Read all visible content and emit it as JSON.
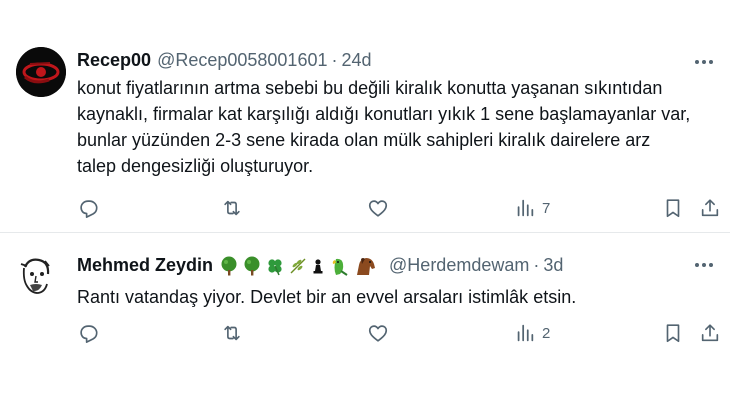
{
  "tweets": [
    {
      "display_name": "Recep00",
      "handle": "@Recep0058001601",
      "separator": "·",
      "time": "24d",
      "text_lines": [
        "konut fiyatlarının artma sebebi bu değili kiralık konutta yaşanan sıkıntıdan",
        "kaynaklı, firmalar kat karşılığı aldığı konutları yıkık 1 sene başlamayanlar var,",
        "bunlar yüzünden 2-3 sene kirada olan mülk sahipleri kiralık dairelere arz",
        "talep dengesizliği oluşturuyor."
      ],
      "views": "7",
      "avatar_icon": "red-eye-logo-icon"
    },
    {
      "display_name": "Mehmed Zeydin",
      "name_emojis": [
        "tree-icon",
        "tree-icon",
        "four-leaf-clover-icon",
        "olive-branch-icon",
        "chess-pawn-icon",
        "parrot-icon",
        "horse-icon"
      ],
      "handle": "@Herdemdewam",
      "separator": "·",
      "time": "3d",
      "text_lines": [
        "Rantı vatandaş yiyor. Devlet bir an evvel arsaları istimlâk etsin."
      ],
      "views": "2",
      "avatar_icon": "sketch-portrait-icon"
    }
  ],
  "colors": {
    "text": "#0f1419",
    "secondary": "#536471",
    "divider": "#e6e9eb"
  }
}
